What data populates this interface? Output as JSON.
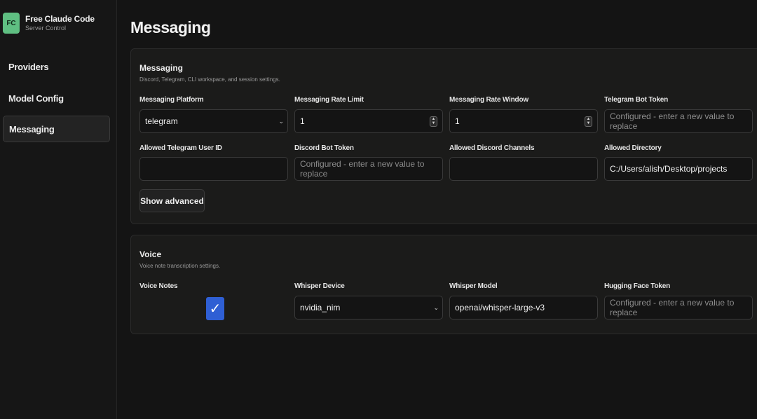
{
  "brand": {
    "logo": "FC",
    "title": "Free Claude Code",
    "subtitle": "Server Control"
  },
  "nav": [
    "Providers",
    "Model Config",
    "Messaging"
  ],
  "page_title": "Messaging",
  "messaging": {
    "title": "Messaging",
    "description": "Discord, Telegram, CLI workspace, and session settings.",
    "fields": {
      "platform": {
        "label": "Messaging Platform",
        "value": "telegram"
      },
      "rate_limit": {
        "label": "Messaging Rate Limit",
        "value": "1"
      },
      "rate_window": {
        "label": "Messaging Rate Window",
        "value": "1"
      },
      "telegram_token": {
        "label": "Telegram Bot Token",
        "placeholder": "Configured - enter a new value to replace"
      },
      "telegram_user": {
        "label": "Allowed Telegram User ID",
        "value": ""
      },
      "discord_token": {
        "label": "Discord Bot Token",
        "placeholder": "Configured - enter a new value to replace"
      },
      "discord_channels": {
        "label": "Allowed Discord Channels",
        "value": ""
      },
      "directory": {
        "label": "Allowed Directory",
        "value": "C:/Users/alish/Desktop/projects"
      }
    },
    "advanced_button": "Show advanced"
  },
  "voice": {
    "title": "Voice",
    "description": "Voice note transcription settings.",
    "fields": {
      "voice_notes": {
        "label": "Voice Notes",
        "checked": true
      },
      "device": {
        "label": "Whisper Device",
        "value": "nvidia_nim"
      },
      "model": {
        "label": "Whisper Model",
        "value": "openai/whisper-large-v3"
      },
      "hf_token": {
        "label": "Hugging Face Token",
        "placeholder": "Configured - enter a new value to replace"
      }
    }
  },
  "colors": {
    "accent": "#5fbf82",
    "checkbox": "#2f5fd4",
    "background": "#141414"
  }
}
